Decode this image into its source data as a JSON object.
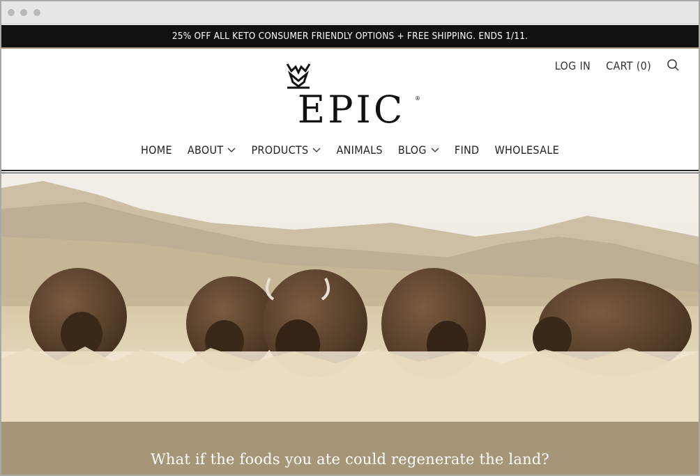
{
  "window": {
    "dots": 3
  },
  "promo": {
    "text": "25% OFF ALL KETO CONSUMER FRIENDLY OPTIONS + FREE SHIPPING. ENDS 1/11."
  },
  "utility": {
    "login": "LOG IN",
    "cart": "CART (0)",
    "search_icon": "search-icon"
  },
  "logo": {
    "wordmark": "EPIC",
    "registered": "®",
    "mark_icon": "bison-skull-icon"
  },
  "nav": {
    "items": [
      {
        "label": "HOME",
        "dropdown": false
      },
      {
        "label": "ABOUT",
        "dropdown": true
      },
      {
        "label": "PRODUCTS",
        "dropdown": true
      },
      {
        "label": "ANIMALS",
        "dropdown": false
      },
      {
        "label": "BLOG",
        "dropdown": true
      },
      {
        "label": "FIND",
        "dropdown": false
      },
      {
        "label": "WHOLESALE",
        "dropdown": false
      }
    ]
  },
  "hero": {
    "image": "bison-herd-grazing-prairie"
  },
  "band": {
    "headline": "What if the foods you ate could regenerate the land?"
  },
  "colors": {
    "promo_bg": "#111111",
    "accent": "#a69577",
    "text": "#222222"
  }
}
